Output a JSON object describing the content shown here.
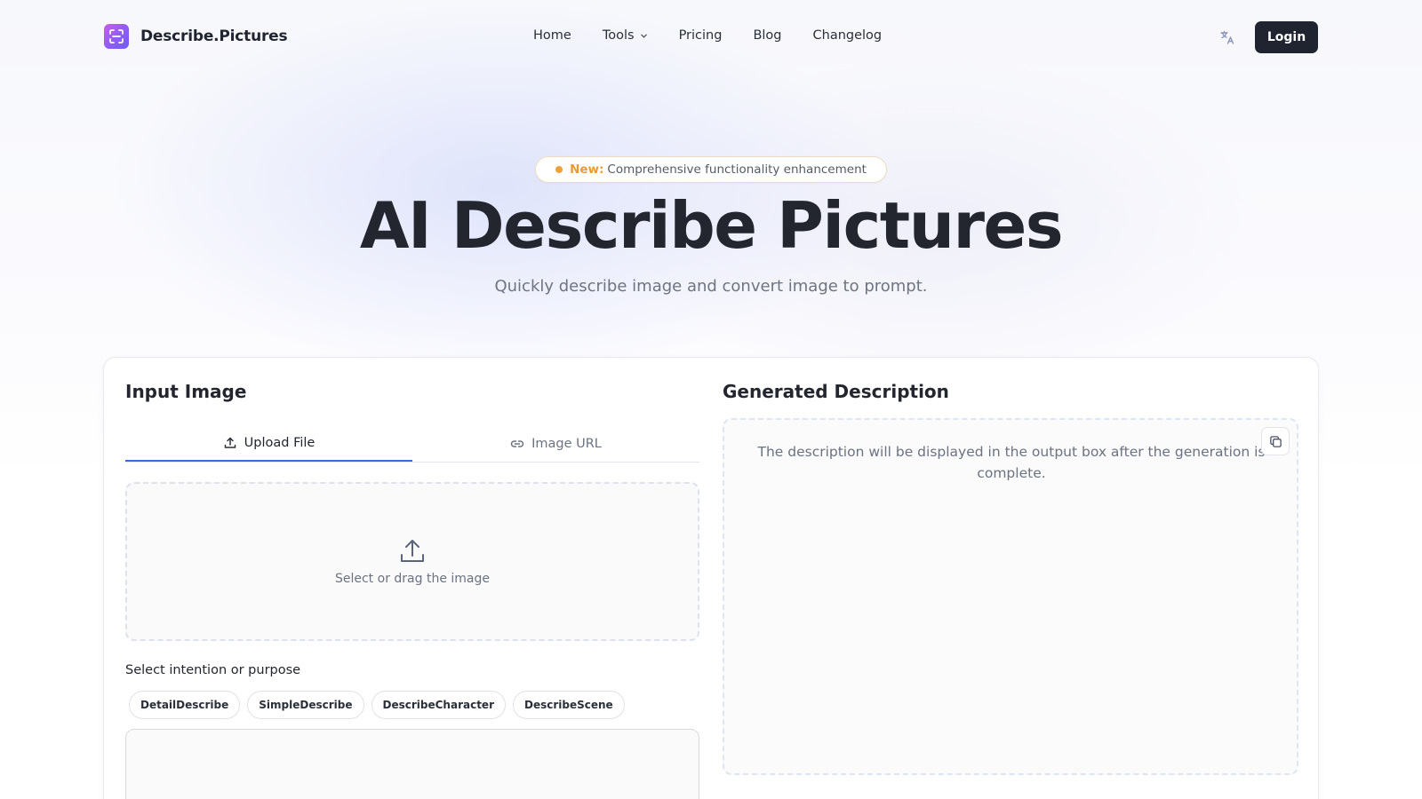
{
  "brand": {
    "name": "Describe.Pictures",
    "logo_icon": "scan-icon"
  },
  "nav": {
    "links": [
      {
        "label": "Home"
      },
      {
        "label": "Tools",
        "has_dropdown": true
      },
      {
        "label": "Pricing"
      },
      {
        "label": "Blog"
      },
      {
        "label": "Changelog"
      }
    ],
    "translate_icon": "translate-icon",
    "login_label": "Login"
  },
  "hero": {
    "badge_new": "New:",
    "badge_text": "Comprehensive functionality enhancement",
    "title": "AI Describe Pictures",
    "subtitle": "Quickly describe image and convert image to prompt."
  },
  "input_panel": {
    "title": "Input Image",
    "tabs": [
      {
        "label": "Upload File",
        "icon": "upload-icon",
        "active": true
      },
      {
        "label": "Image URL",
        "icon": "link-icon",
        "active": false
      }
    ],
    "dropzone_text": "Select or drag the image",
    "intent_label": "Select intention or purpose",
    "chips": [
      "DetailDescribe",
      "SimpleDescribe",
      "DescribeCharacter",
      "DescribeScene"
    ]
  },
  "output_panel": {
    "title": "Generated Description",
    "placeholder": "The description will be displayed in the output box after the generation is complete.",
    "copy_icon": "copy-icon"
  },
  "colors": {
    "primary_dark": "#1f2430",
    "accent_blue": "#3b6be0",
    "badge_orange": "#ef9a2e",
    "logo_gradient": [
      "#c45cf5",
      "#6d5cf0"
    ]
  }
}
